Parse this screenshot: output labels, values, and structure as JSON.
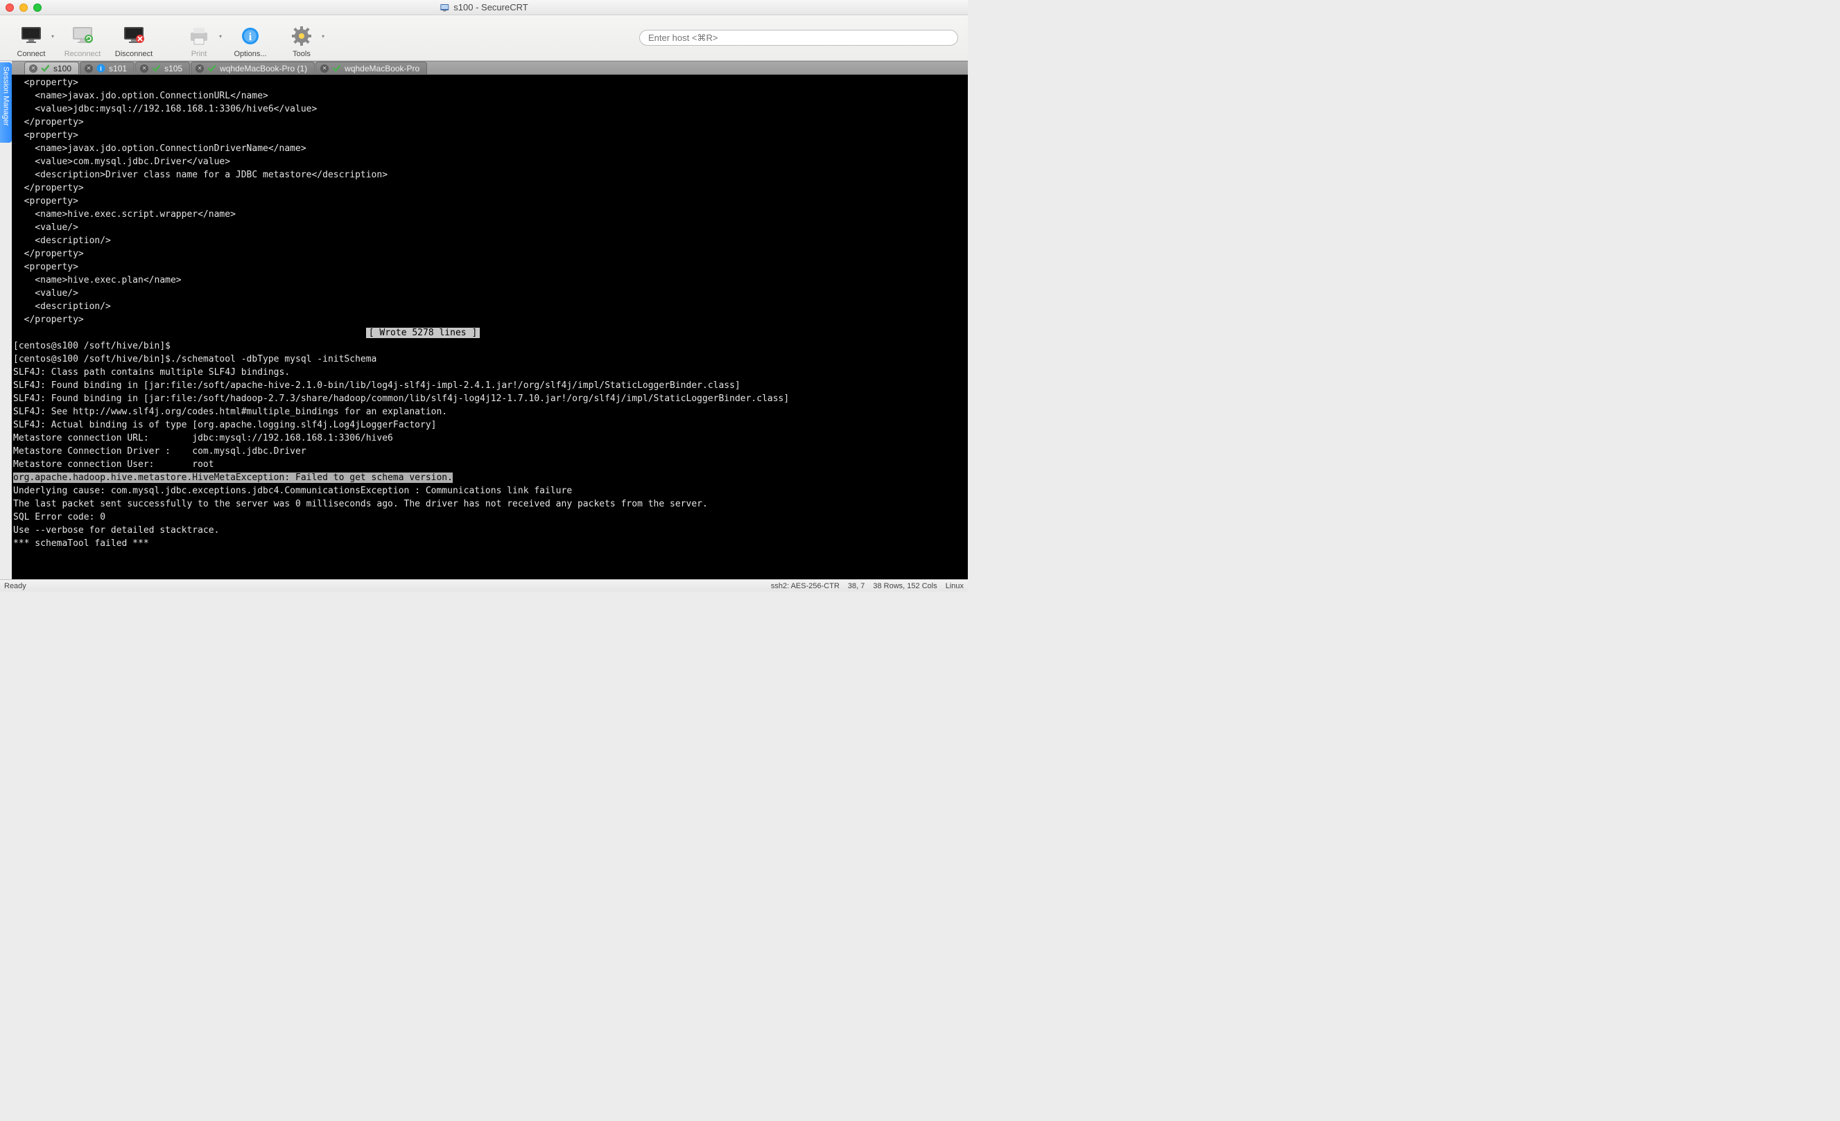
{
  "window": {
    "title": "s100 - SecureCRT"
  },
  "toolbar": {
    "connect": "Connect",
    "reconnect": "Reconnect",
    "disconnect": "Disconnect",
    "print": "Print",
    "options": "Options...",
    "tools": "Tools"
  },
  "search": {
    "placeholder": "Enter host <⌘R>"
  },
  "session_manager_label": "Session Manager",
  "tabs": [
    {
      "label": "s100",
      "active": true,
      "icon": "check"
    },
    {
      "label": "s101",
      "active": false,
      "icon": "info"
    },
    {
      "label": "s105",
      "active": false,
      "icon": "check"
    },
    {
      "label": "wqhdeMacBook-Pro (1)",
      "active": false,
      "icon": "check"
    },
    {
      "label": "wqhdeMacBook-Pro",
      "active": false,
      "icon": "check"
    }
  ],
  "terminal": {
    "lines": [
      "  <property>",
      "    <name>javax.jdo.option.ConnectionURL</name>",
      "    <value>jdbc:mysql://192.168.168.1:3306/hive6</value>",
      "  </property>",
      "  <property>",
      "    <name>javax.jdo.option.ConnectionDriverName</name>",
      "    <value>com.mysql.jdbc.Driver</value>",
      "    <description>Driver class name for a JDBC metastore</description>",
      "  </property>",
      "  <property>",
      "    <name>hive.exec.script.wrapper</name>",
      "    <value/>",
      "    <description/>",
      "  </property>",
      "  <property>",
      "    <name>hive.exec.plan</name>",
      "    <value/>",
      "    <description/>",
      "  </property>"
    ],
    "wrote_msg": "[ Wrote 5278 lines ]",
    "lines2": [
      "[centos@s100 /soft/hive/bin]$",
      "[centos@s100 /soft/hive/bin]$./schematool -dbType mysql -initSchema",
      "SLF4J: Class path contains multiple SLF4J bindings.",
      "SLF4J: Found binding in [jar:file:/soft/apache-hive-2.1.0-bin/lib/log4j-slf4j-impl-2.4.1.jar!/org/slf4j/impl/StaticLoggerBinder.class]",
      "SLF4J: Found binding in [jar:file:/soft/hadoop-2.7.3/share/hadoop/common/lib/slf4j-log4j12-1.7.10.jar!/org/slf4j/impl/StaticLoggerBinder.class]",
      "SLF4J: See http://www.slf4j.org/codes.html#multiple_bindings for an explanation.",
      "SLF4J: Actual binding is of type [org.apache.logging.slf4j.Log4jLoggerFactory]",
      "Metastore connection URL:        jdbc:mysql://192.168.168.1:3306/hive6",
      "Metastore Connection Driver :    com.mysql.jdbc.Driver",
      "Metastore connection User:       root"
    ],
    "error_line": "org.apache.hadoop.hive.metastore.HiveMetaException: Failed to get schema version.",
    "lines3": [
      "Underlying cause: com.mysql.jdbc.exceptions.jdbc4.CommunicationsException : Communications link failure",
      "",
      "The last packet sent successfully to the server was 0 milliseconds ago. The driver has not received any packets from the server.",
      "SQL Error code: 0",
      "Use --verbose for detailed stacktrace.",
      "*** schemaTool failed ***"
    ]
  },
  "statusbar": {
    "ready": "Ready",
    "cipher": "ssh2: AES-256-CTR",
    "pos": "38, 7",
    "dims": "38 Rows, 152 Cols",
    "platform": "Linux"
  }
}
